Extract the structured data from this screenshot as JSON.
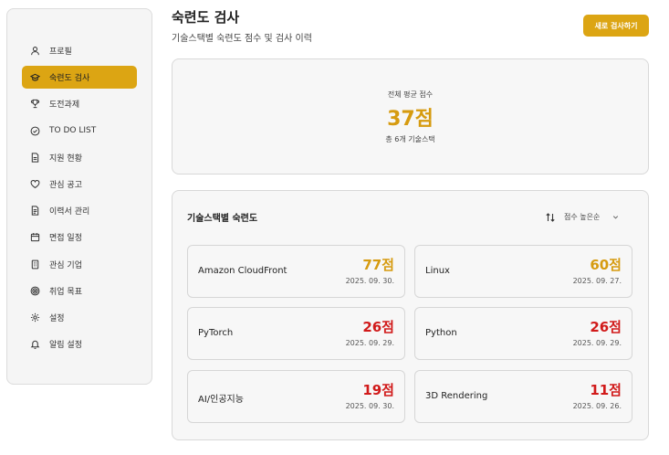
{
  "sidebar": {
    "items": [
      {
        "label": "프로필",
        "icon": "user-icon"
      },
      {
        "label": "숙련도 검사",
        "icon": "graduation-cap-icon",
        "active": true
      },
      {
        "label": "도전과제",
        "icon": "trophy-icon"
      },
      {
        "label": "TO DO LIST",
        "icon": "check-circle-icon"
      },
      {
        "label": "지원 현황",
        "icon": "document-icon"
      },
      {
        "label": "관심 공고",
        "icon": "heart-icon"
      },
      {
        "label": "이력서 관리",
        "icon": "file-text-icon"
      },
      {
        "label": "면접 일정",
        "icon": "calendar-icon"
      },
      {
        "label": "관심 기업",
        "icon": "building-icon"
      },
      {
        "label": "취업 목표",
        "icon": "target-icon"
      },
      {
        "label": "설정",
        "icon": "gear-icon"
      },
      {
        "label": "알림 설정",
        "icon": "bell-icon"
      }
    ]
  },
  "header": {
    "title": "숙련도 검사",
    "subtitle": "기술스택별 숙련도 점수 및 검사 이력",
    "new_test_label": "새로 검사하기"
  },
  "summary": {
    "label": "전체 평균 점수",
    "score": "37점",
    "count": "총 6개 기술스택"
  },
  "skills_section": {
    "title": "기술스택별 숙련도",
    "sort_label": "점수 높은순",
    "items": [
      {
        "name": "Amazon CloudFront",
        "score": "77점",
        "date": "2025. 09. 30."
      },
      {
        "name": "Linux",
        "score": "60점",
        "date": "2025. 09. 27."
      },
      {
        "name": "PyTorch",
        "score": "26점",
        "date": "2025. 09. 29."
      },
      {
        "name": "Python",
        "score": "26점",
        "date": "2025. 09. 29."
      },
      {
        "name": "AI/인공지능",
        "score": "19점",
        "date": "2025. 09. 30."
      },
      {
        "name": "3D Rendering",
        "score": "11점",
        "date": "2025. 09. 26."
      }
    ]
  },
  "colors": {
    "accent": "#dca513",
    "score_high": "#d69b10",
    "score_low": "#d11a1a"
  }
}
